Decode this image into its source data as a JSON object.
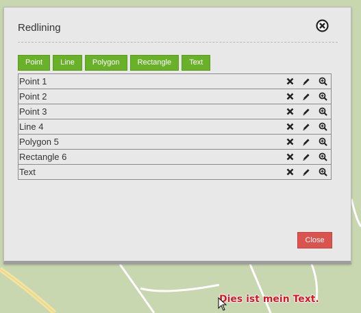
{
  "dialog": {
    "title": "Redlining",
    "close_label": "Close"
  },
  "toolbar": {
    "buttons": [
      "Point",
      "Line",
      "Polygon",
      "Rectangle",
      "Text"
    ]
  },
  "features": [
    {
      "label": "Point 1"
    },
    {
      "label": "Point 2"
    },
    {
      "label": "Point 3"
    },
    {
      "label": "Line 4"
    },
    {
      "label": "Polygon 5"
    },
    {
      "label": "Rectangle 6"
    },
    {
      "label": "Text"
    }
  ],
  "row_actions": [
    "delete-icon",
    "edit-pencil-icon",
    "zoom-in-icon"
  ],
  "map": {
    "label_text": "Dies ist mein Text.",
    "label_color": "#e0121f"
  },
  "colors": {
    "tool_button": "#6ab12a",
    "close_button": "#d9534f",
    "dialog_bg": "#e8e8e8",
    "map_bg": "#c9d7b0"
  }
}
